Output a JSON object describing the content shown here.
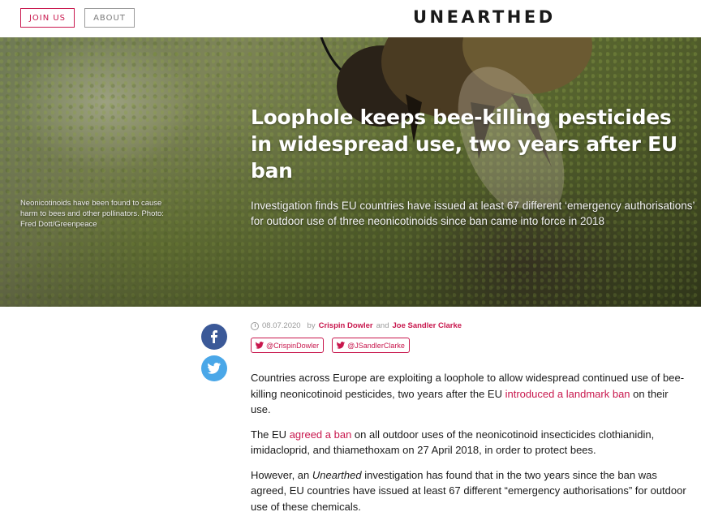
{
  "header": {
    "join_label": "JOIN US",
    "about_label": "ABOUT",
    "logo_text": "UNEARTHED"
  },
  "hero": {
    "headline": "Loophole keeps bee-killing pesticides in widespread use, two years after EU ban",
    "standfirst": "Investigation finds EU countries have issued at least 67 different ‘emergency authorisations’ for outdoor use of three neonicotinoids since ban came into force in 2018",
    "caption": "Neonicotinoids have been found to cause harm to bees and other pollinators. Photo: Fred Dott/Greenpeace"
  },
  "share": {
    "facebook_icon": "facebook-icon",
    "twitter_icon": "twitter-icon"
  },
  "meta": {
    "date": "08.07.2020",
    "by": "by",
    "author1": "Crispin Dowler",
    "and": "and",
    "author2": "Joe Sandler Clarke",
    "handle1": "@CrispinDowler",
    "handle2": "@JSandlerClarke"
  },
  "article": {
    "p1_a": "Countries across Europe are exploiting a loophole to allow widespread continued use of bee-killing neonicotinoid pesticides, two years after the EU ",
    "p1_link": "introduced a landmark ban",
    "p1_b": " on their use.",
    "p2_a": "The EU ",
    "p2_link": "agreed a ban",
    "p2_b": " on all outdoor uses of the neonicotinoid insecticides clothianidin, imidacloprid, and thiamethoxam on 27 April 2018, in order to protect bees.",
    "p3_a": "However, an ",
    "p3_em": "Unearthed",
    "p3_b": " investigation has found that in the two years since the ban was agreed, EU countries have issued at least 67 different “emergency authorisations” for outdoor use of these chemicals."
  },
  "colors": {
    "accent": "#c8174d",
    "facebook": "#3b5998",
    "twitter": "#4aa7e8"
  }
}
